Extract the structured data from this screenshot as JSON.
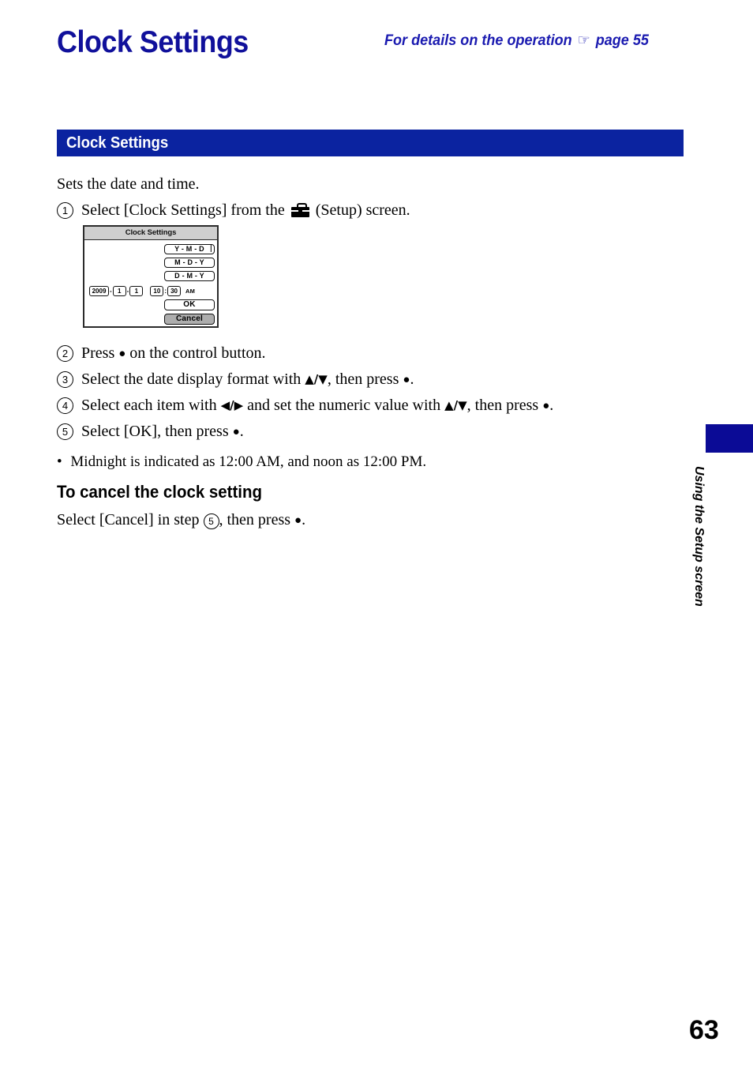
{
  "page": {
    "title": "Clock Settings",
    "operation_note_prefix": "For details on the operation",
    "operation_note_hand_icon": "pointing-hand-icon",
    "operation_note_page": "page 55",
    "page_number": "63",
    "side_label": "Using the Setup screen",
    "accent_blue": "#10109b",
    "bar_blue": "#0b23a0",
    "tab_blue": "#0b0b96"
  },
  "section": {
    "heading": "Clock Settings"
  },
  "body": {
    "intro": "Sets the date and time.",
    "steps": [
      {
        "num": "1",
        "before": "Select [Clock Settings] from the",
        "icon": "toolbox-icon",
        "after": "(Setup) screen."
      },
      {
        "num": "2",
        "text_a": "Press",
        "bullet": "●",
        "text_b": "on the control button."
      },
      {
        "num": "3",
        "text_a": "Select the date display format with",
        "arrows_a": "▲/▼",
        "text_b": ", then press",
        "bullet": "●",
        "text_c": "."
      },
      {
        "num": "4",
        "text_a": "Select each item with",
        "arrows_a": "◀/▶",
        "text_b": "and set the numeric value with",
        "arrows_b": "▲/▼",
        "text_c": ", then press",
        "bullet": "●",
        "text_d": "."
      },
      {
        "num": "5",
        "text_a": "Select [OK], then press",
        "bullet": "●",
        "text_b": "."
      }
    ],
    "note_bullet": "•",
    "note": "Midnight is indicated as 12:00 AM, and noon as 12:00 PM.",
    "subheading": "To cancel the clock setting",
    "cancel_before": "Select [Cancel] in step",
    "cancel_step_num": "5",
    "cancel_after": ", then press",
    "cancel_bullet": "●",
    "cancel_end": "."
  },
  "screen_mock": {
    "title": "Clock Settings",
    "format_options": [
      {
        "label": "Y - M - D",
        "selected": true,
        "cursor": "⟦"
      },
      {
        "label": "M - D - Y",
        "selected": false
      },
      {
        "label": "D - M - Y",
        "selected": false
      }
    ],
    "date": {
      "year": "2009",
      "month": "1",
      "day": "1",
      "hour": "10",
      "minute": "30",
      "ampm": "AM",
      "date_sep": "-",
      "time_sep": ":"
    },
    "ok_label": "OK",
    "cancel_label": "Cancel",
    "highlighted_button": "Cancel"
  }
}
